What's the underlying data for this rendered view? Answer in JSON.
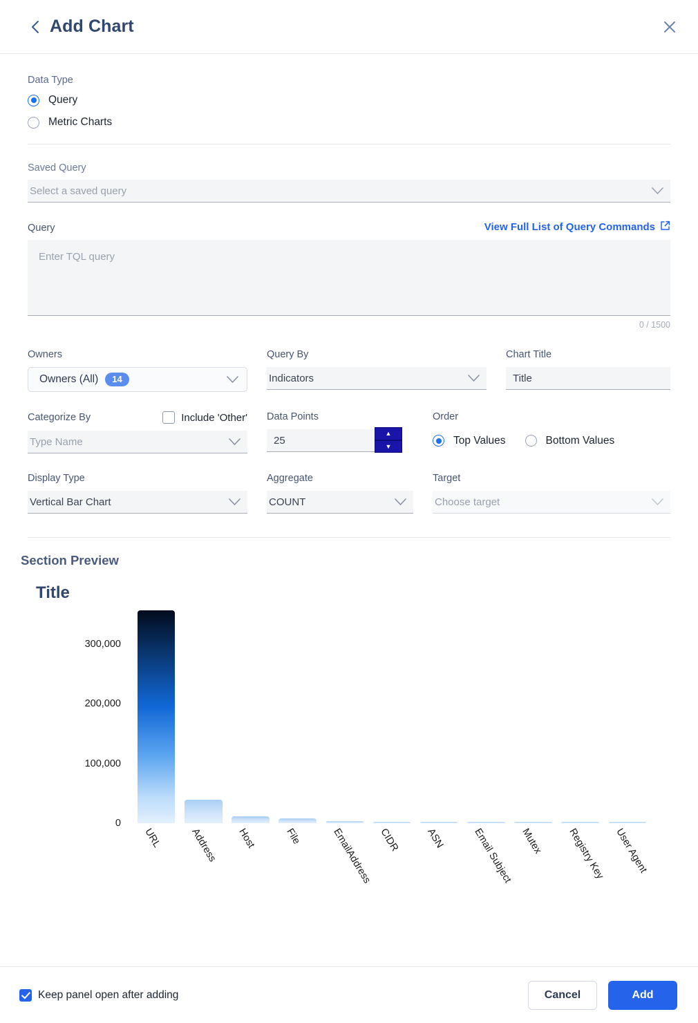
{
  "header": {
    "title": "Add Chart",
    "back_icon": "chevron-left-icon",
    "close_icon": "close-icon"
  },
  "data_type": {
    "label": "Data Type",
    "options": [
      {
        "label": "Query",
        "selected": true
      },
      {
        "label": "Metric Charts",
        "selected": false
      }
    ]
  },
  "saved_query": {
    "label": "Saved Query",
    "placeholder": "Select a saved query",
    "value": "Select a saved query",
    "chevron_icon": "chevron-down-icon"
  },
  "query": {
    "label": "Query",
    "link_label": "View Full List of Query Commands",
    "link_icon": "external-link-icon",
    "placeholder": "Enter TQL query",
    "value": "",
    "counter": "0 / 1500"
  },
  "owners": {
    "label": "Owners",
    "value": "Owners (All)",
    "count": "14",
    "chevron_icon": "chevron-down-icon"
  },
  "query_by": {
    "label": "Query By",
    "value": "Indicators",
    "chevron_icon": "chevron-down-icon"
  },
  "chart_title": {
    "label": "Chart Title",
    "value": "Title",
    "placeholder": "Title"
  },
  "categorize_by": {
    "label": "Categorize By",
    "value": "Type Name",
    "chevron_icon": "chevron-down-icon"
  },
  "include_other": {
    "label": "Include 'Other'",
    "checked": false
  },
  "data_points": {
    "label": "Data Points",
    "value": "25",
    "up_icon": "triangle-up-icon",
    "down_icon": "triangle-down-icon"
  },
  "order": {
    "label": "Order",
    "options": [
      {
        "label": "Top Values",
        "selected": true
      },
      {
        "label": "Bottom Values",
        "selected": false
      }
    ]
  },
  "display_type": {
    "label": "Display Type",
    "value": "Vertical Bar Chart",
    "chevron_icon": "chevron-down-icon"
  },
  "aggregate": {
    "label": "Aggregate",
    "value": "COUNT",
    "chevron_icon": "chevron-down-icon"
  },
  "target": {
    "label": "Target",
    "value": "Choose target",
    "placeholder": "Choose target",
    "chevron_icon": "chevron-down-icon"
  },
  "preview": {
    "heading": "Section Preview"
  },
  "footer": {
    "keep_open_label": "Keep panel open after adding",
    "keep_open_checked": true,
    "cancel_label": "Cancel",
    "add_label": "Add"
  },
  "chart_data": {
    "type": "bar",
    "title": "Title",
    "xlabel": "",
    "ylabel": "",
    "ylim": [
      0,
      360000
    ],
    "grid": false,
    "legend": false,
    "ytick_labels": [
      "300,000",
      "200,000",
      "100,000",
      "0"
    ],
    "ytick_values": [
      300000,
      200000,
      100000,
      0
    ],
    "categories": [
      "URL",
      "Address",
      "Host",
      "File",
      "EmailAddress",
      "CIDR",
      "ASN",
      "Email Subject",
      "Mutex",
      "Registry Key",
      "User Agent"
    ],
    "values": [
      356000,
      39000,
      11500,
      8500,
      3000,
      2600,
      2400,
      2200,
      2000,
      1800,
      1600
    ]
  }
}
